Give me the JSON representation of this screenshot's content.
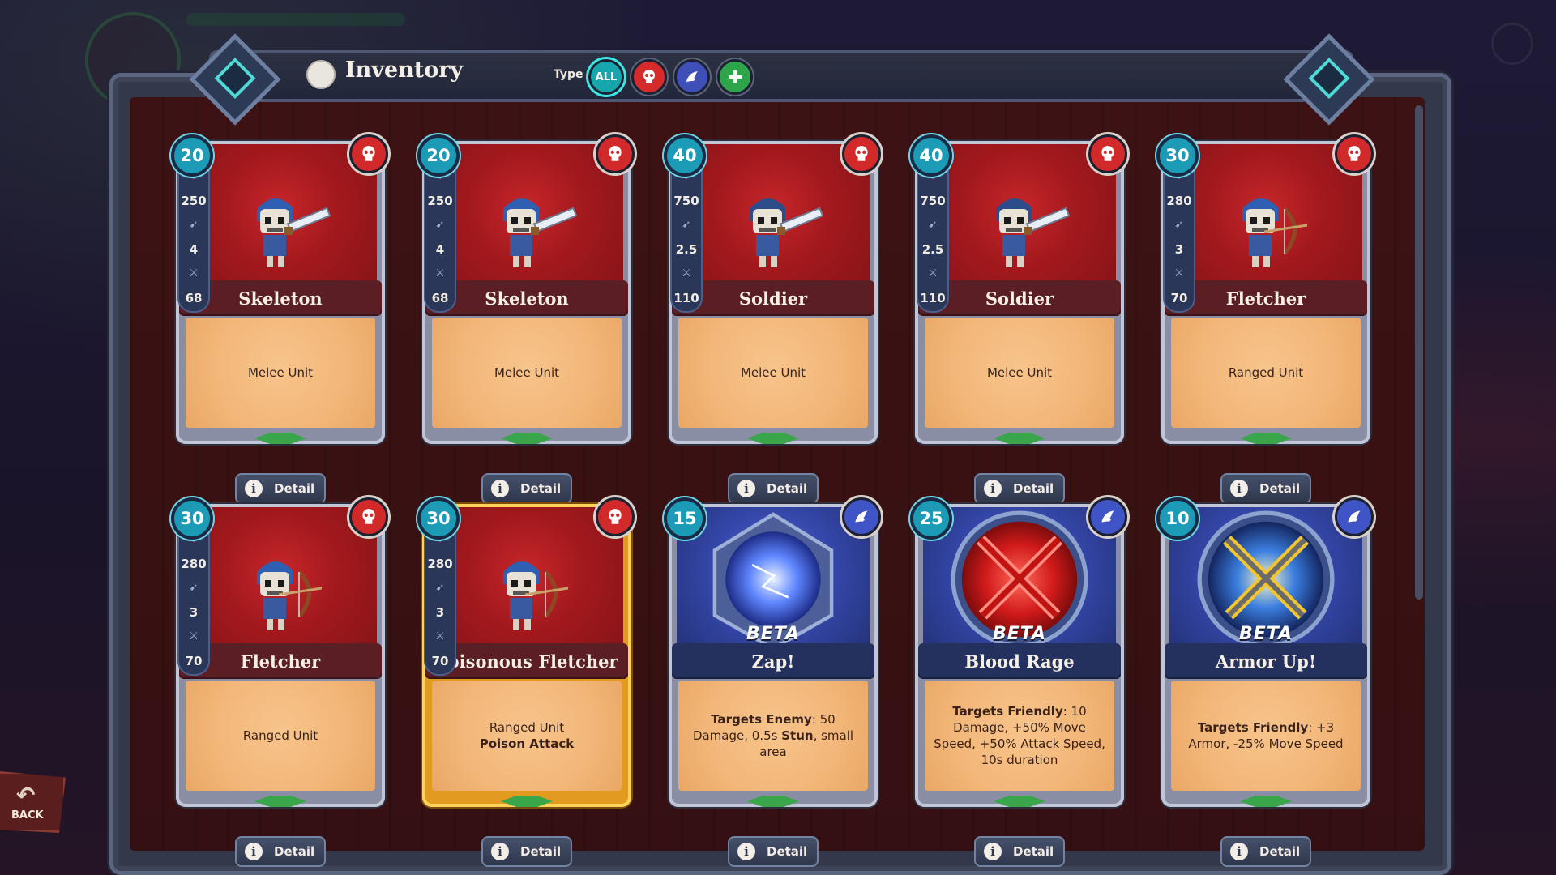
{
  "header": {
    "title": "Inventory",
    "type_label": "Type",
    "filters": [
      {
        "label": "ALL",
        "icon": "all-filter",
        "color": "#16a6ad",
        "selected": true
      },
      {
        "label": "",
        "icon": "skull-icon",
        "color": "#d62b2b",
        "selected": false
      },
      {
        "label": "",
        "icon": "dragon-icon",
        "color": "#3f4fb8",
        "selected": false
      },
      {
        "label": "",
        "icon": "cross-icon",
        "color": "#2ea54a",
        "selected": false
      }
    ]
  },
  "cards": [
    {
      "level": "20",
      "name": "Skeleton",
      "kind": "unit",
      "faction": "red",
      "hp": "250",
      "speed": "4",
      "attack": "68",
      "desc": "Melee Unit",
      "desc2": "",
      "detail": "Detail"
    },
    {
      "level": "20",
      "name": "Skeleton",
      "kind": "unit",
      "faction": "red",
      "hp": "250",
      "speed": "4",
      "attack": "68",
      "desc": "Melee Unit",
      "desc2": "",
      "detail": "Detail"
    },
    {
      "level": "40",
      "name": "Soldier",
      "kind": "unit",
      "faction": "red",
      "hp": "750",
      "speed": "2.5",
      "attack": "110",
      "desc": "Melee Unit",
      "desc2": "",
      "detail": "Detail"
    },
    {
      "level": "40",
      "name": "Soldier",
      "kind": "unit",
      "faction": "red",
      "hp": "750",
      "speed": "2.5",
      "attack": "110",
      "desc": "Melee Unit",
      "desc2": "",
      "detail": "Detail"
    },
    {
      "level": "30",
      "name": "Fletcher",
      "kind": "unit",
      "faction": "red",
      "hp": "280",
      "speed": "3",
      "attack": "70",
      "desc": "Ranged Unit",
      "desc2": "",
      "detail": "Detail"
    },
    {
      "level": "30",
      "name": "Fletcher",
      "kind": "unit",
      "faction": "red",
      "hp": "280",
      "speed": "3",
      "attack": "70",
      "desc": "Ranged Unit",
      "desc2": "",
      "detail": "Detail"
    },
    {
      "level": "30",
      "name": "Poisonous Fletcher",
      "kind": "unit",
      "faction": "red",
      "hp": "280",
      "speed": "3",
      "attack": "70",
      "desc": "Ranged Unit",
      "desc2": "Poison Attack",
      "detail": "Detail",
      "highlighted": true
    },
    {
      "level": "15",
      "name": "Zap!",
      "kind": "spell",
      "faction": "blue",
      "beta": "BETA",
      "desc_bold": "Targets Enemy",
      "desc": ": 50 Damage, 0.5s ",
      "desc_bold2": "Stun",
      "desc_tail": ", small area",
      "detail": "Detail"
    },
    {
      "level": "25",
      "name": "Blood Rage",
      "kind": "spell",
      "faction": "blue",
      "beta": "BETA",
      "desc_bold": "Targets Friendly",
      "desc": ": 10 Damage, +50% Move Speed, +50% Attack Speed, 10s duration",
      "desc_bold2": "",
      "desc_tail": "",
      "detail": "Detail"
    },
    {
      "level": "10",
      "name": "Armor Up!",
      "kind": "spell",
      "faction": "blue",
      "beta": "BETA",
      "desc_bold": "Targets Friendly",
      "desc": ": +3 Armor, -25% Move Speed",
      "desc_bold2": "",
      "desc_tail": "",
      "detail": "Detail"
    }
  ],
  "back_button": {
    "label": "BACK"
  }
}
